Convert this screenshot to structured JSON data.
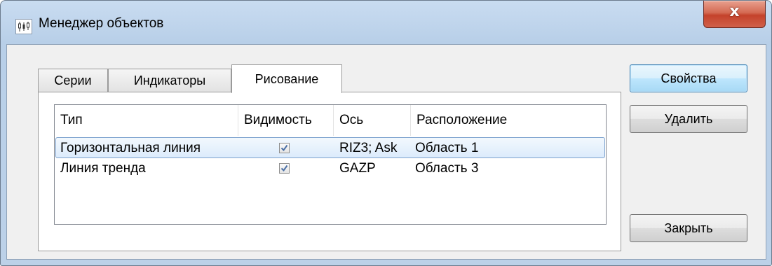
{
  "window": {
    "title": "Менеджер объектов",
    "close_label": "x"
  },
  "tabs": [
    {
      "label": "Серии",
      "active": false
    },
    {
      "label": "Индикаторы",
      "active": false
    },
    {
      "label": "Рисование",
      "active": true
    }
  ],
  "list": {
    "columns": [
      "Тип",
      "Видимость",
      "Ось",
      "Расположение"
    ],
    "rows": [
      {
        "type": "Горизонтальная линия",
        "visible": true,
        "axis": "RIZ3; Ask",
        "location": "Область 1",
        "selected": true
      },
      {
        "type": "Линия тренда",
        "visible": true,
        "axis": "GAZP",
        "location": "Область 3",
        "selected": false
      }
    ]
  },
  "buttons": {
    "properties": "Свойства",
    "delete": "Удалить",
    "close": "Закрыть"
  },
  "icons": {
    "app": "chart-candles-icon",
    "close": "close-x-icon",
    "checkbox": "checkmark-icon"
  },
  "colors": {
    "close_button": "#c4422b",
    "selected_row": "#dcebfc",
    "default_button": "#bee6fd"
  }
}
